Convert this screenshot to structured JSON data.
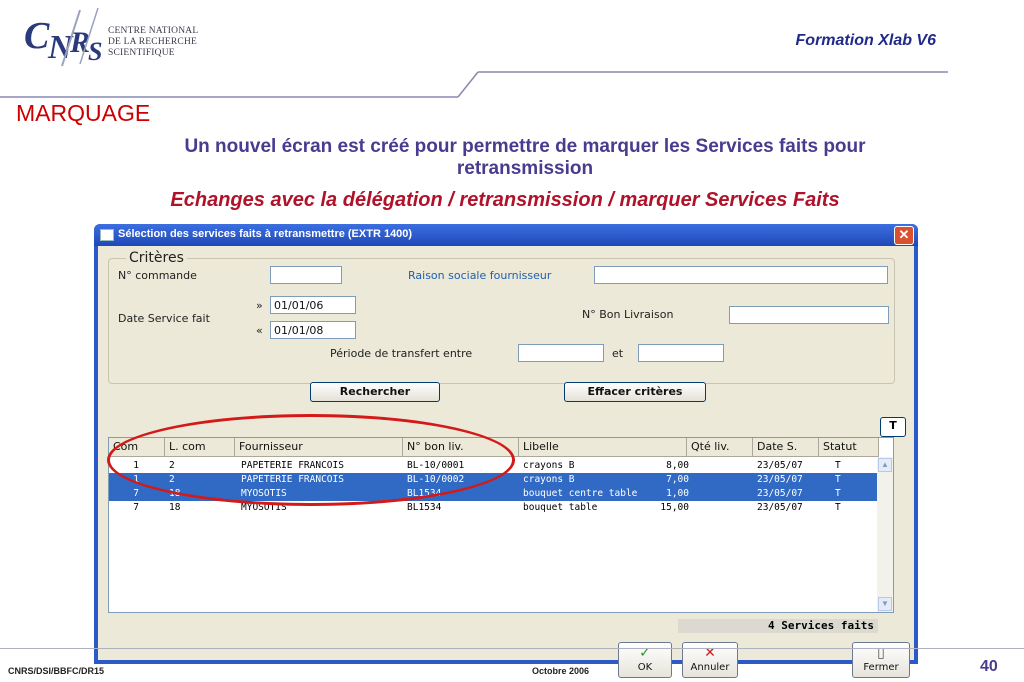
{
  "header": {
    "logo_name": "CNRS",
    "logo_lines": [
      "CENTRE NATIONAL",
      "DE LA RECHERCHE",
      "SCIENTIFIQUE"
    ],
    "course": "Formation Xlab V6"
  },
  "slide": {
    "title": "MARQUAGE",
    "subtitle_line1": "Un nouvel écran est créé pour permettre de marquer les Services faits pour",
    "subtitle_line2": "retransmission",
    "subtitle2": "Echanges avec la délégation / retransmission / marquer Services Faits"
  },
  "window": {
    "title": "Sélection des services faits à retransmettre     (EXTR 1400)",
    "close_label": "✕",
    "criteria": {
      "legend": "Critères",
      "commande_label": "N° commande",
      "commande_value": "",
      "raison_label": "Raison sociale fournisseur",
      "raison_value": "",
      "date_label": "Date Service fait",
      "date_from_prefix": "»",
      "date_from": "01/01/06",
      "date_to_prefix": "«",
      "date_to": "01/01/08",
      "bon_label": "N° Bon Livraison",
      "bon_value": "",
      "periode_label": "Période de transfert entre",
      "periode_from": "",
      "et_label": "et",
      "periode_to": ""
    },
    "buttons": {
      "search": "Rechercher",
      "clear": "Effacer critères",
      "toggle": "T"
    },
    "grid": {
      "columns": [
        "Com",
        "L. com",
        "Fournisseur",
        "N° bon liv.",
        "Libelle",
        "Qté liv.",
        "Date S.",
        "Statut"
      ],
      "rows": [
        {
          "com": "1",
          "lcom": "2",
          "fournisseur": "PAPETERIE FRANCOIS",
          "bon": "BL-10/0001",
          "libelle": "crayons B",
          "qte": "8,00",
          "date": "23/05/07",
          "statut": "T",
          "selected": false
        },
        {
          "com": "1",
          "lcom": "2",
          "fournisseur": "PAPETERIE FRANCOIS",
          "bon": "BL-10/0002",
          "libelle": "crayons B",
          "qte": "7,00",
          "date": "23/05/07",
          "statut": "T",
          "selected": true
        },
        {
          "com": "7",
          "lcom": "18",
          "fournisseur": "MYOSOTIS",
          "bon": "BL1534",
          "libelle": "bouquet centre table",
          "qte": "1,00",
          "date": "23/05/07",
          "statut": "T",
          "selected": true
        },
        {
          "com": "7",
          "lcom": "18",
          "fournisseur": "MYOSOTIS",
          "bon": "BL1534",
          "libelle": "bouquet table",
          "qte": "15,00",
          "date": "23/05/07",
          "statut": "T",
          "selected": false
        }
      ]
    },
    "count_text": "4 Services faits",
    "actions": {
      "ok": "OK",
      "cancel": "Annuler",
      "close": "Fermer"
    }
  },
  "footer": {
    "left": "CNRS/DSI/BBFC/DR15",
    "middle": "Octobre 2006",
    "page": "40"
  },
  "colors": {
    "title_red": "#cc0000",
    "subtitle_purple": "#4a3b8f",
    "selection_blue": "#316ac5",
    "annotation_red": "#d41919"
  }
}
